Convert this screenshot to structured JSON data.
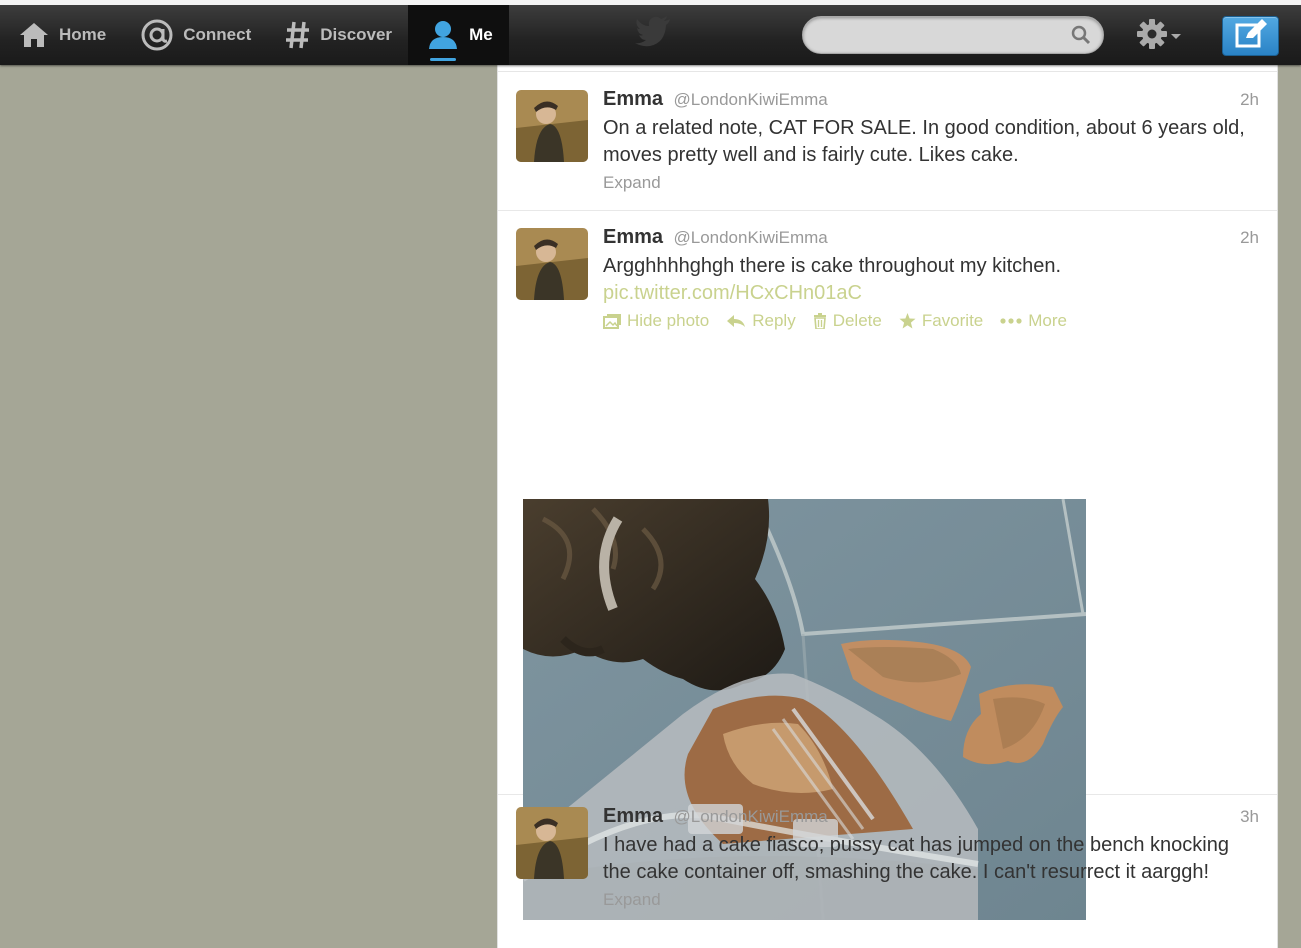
{
  "topbar": {
    "nav": [
      {
        "label": "Home",
        "icon": "home-icon"
      },
      {
        "label": "Connect",
        "icon": "at-icon"
      },
      {
        "label": "Discover",
        "icon": "hash-icon"
      },
      {
        "label": "Me",
        "icon": "user-icon",
        "active": true
      }
    ],
    "search": {
      "value": "",
      "placeholder": ""
    },
    "brand_icon": "twitter-bird-icon",
    "settings_icon": "gear-icon",
    "compose_icon": "compose-icon"
  },
  "colors": {
    "page_bg": "#a5a696",
    "topbar_bg": "#222222",
    "link": "#c9d28e",
    "compose": "#3a96d6",
    "active_underline": "#41a4e0"
  },
  "tweets": [
    {
      "name": "Emma",
      "handle": "@LondonKiwiEmma",
      "time": "2h",
      "text": "On a related note, CAT FOR SALE. In good condition, about 6 years old, moves pretty well and is fairly cute. Likes cake.",
      "expand": "Expand"
    },
    {
      "name": "Emma",
      "handle": "@LondonKiwiEmma",
      "time": "2h",
      "text": "Argghhhhghgh there is cake throughout my kitchen.",
      "link": "pic.twitter.com/HCxCHn01aC",
      "actions": {
        "hide_photo": "Hide photo",
        "reply": "Reply",
        "delete": "Delete",
        "favorite": "Favorite",
        "more": "More"
      }
    },
    {
      "name": "Emma",
      "handle": "@LondonKiwiEmma",
      "time": "3h",
      "text": "I have had a cake fiasco; pussy cat has jumped on the bench knocking the cake container off, smashing the cake. I can't resurrect it aarggh!",
      "expand": "Expand"
    }
  ]
}
